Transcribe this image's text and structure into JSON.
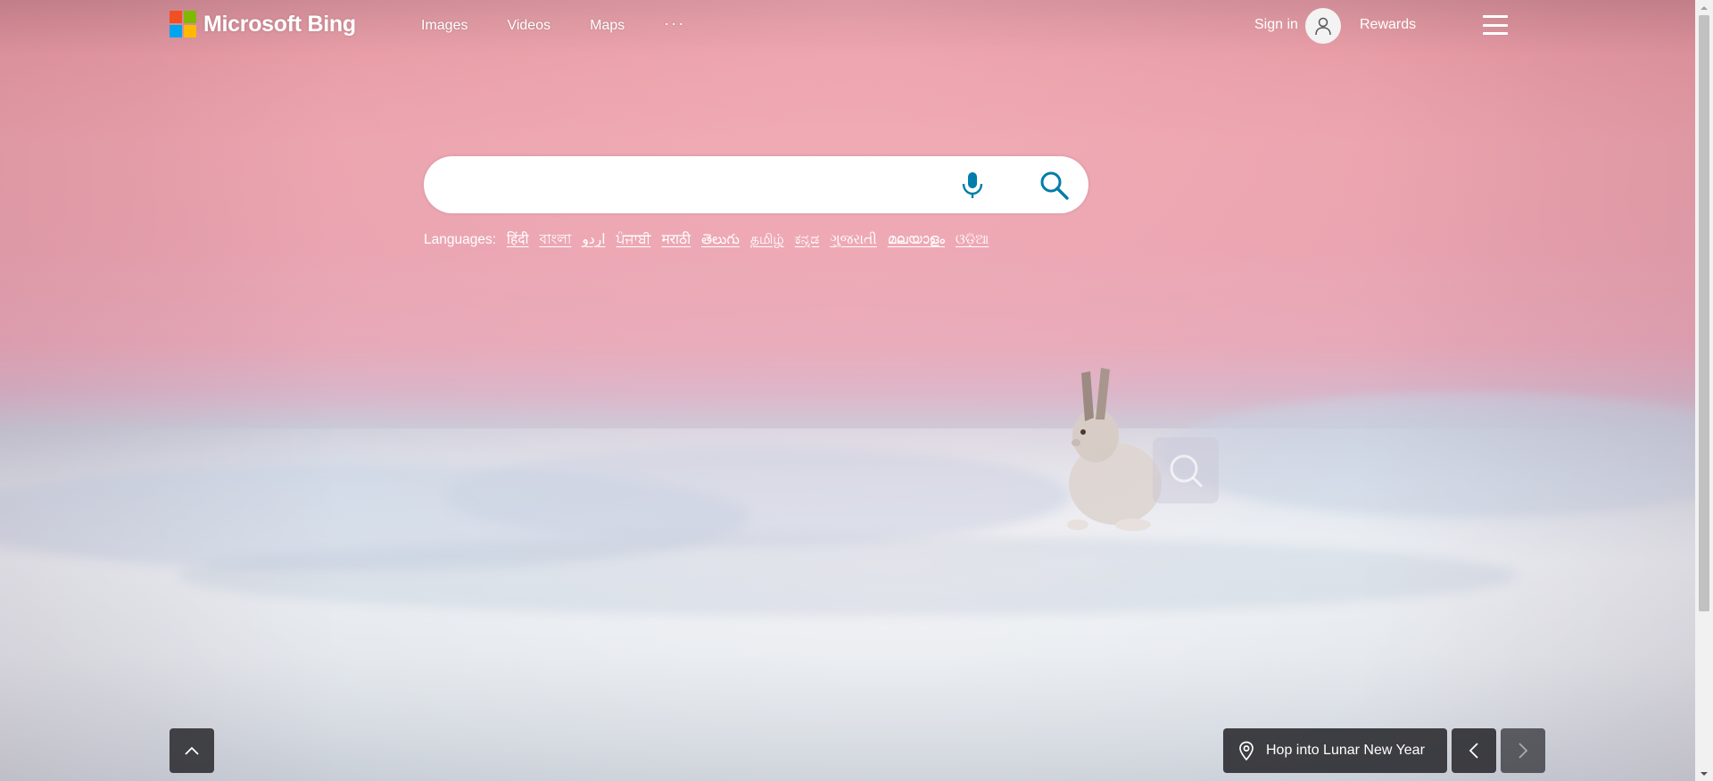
{
  "header": {
    "brand": "Microsoft Bing",
    "brand_colors": [
      "#f25022",
      "#7fba00",
      "#00a4ef",
      "#ffb900"
    ],
    "nav": [
      {
        "label": "Images"
      },
      {
        "label": "Videos"
      },
      {
        "label": "Maps"
      },
      {
        "label": "···"
      }
    ],
    "sign_in": "Sign in",
    "rewards": "Rewards"
  },
  "search": {
    "value": "",
    "placeholder": "",
    "accent": "#007daa"
  },
  "languages": {
    "label": "Languages:",
    "items": [
      "हिंदी",
      "বাংলা",
      "اردو",
      "ਪੰਜਾਬੀ",
      "मराठी",
      "తెలుగు",
      "தமிழ்",
      "ಕನ್ನಡ",
      "ગુજરાતી",
      "മലയാളം",
      "ଓଡ଼ିଆ"
    ]
  },
  "footer": {
    "story_title": "Hop into Lunar New Year"
  },
  "icons": {
    "microphone": "microphone-icon",
    "search": "search-icon",
    "user": "user-icon",
    "menu": "hamburger-icon",
    "location": "location-pin-icon",
    "chevron_up": "chevron-up-icon",
    "chevron_left": "chevron-left-icon",
    "chevron_right": "chevron-right-icon",
    "visual_search": "visual-search-icon"
  }
}
